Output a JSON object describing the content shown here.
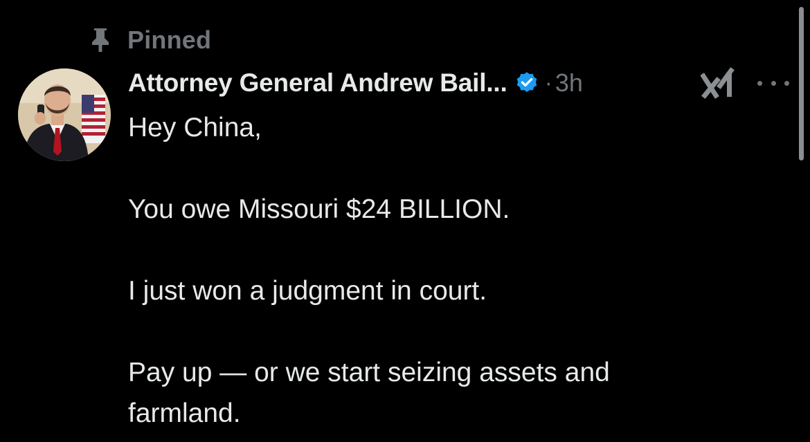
{
  "pinned": {
    "label": "Pinned",
    "icon": "pin-icon"
  },
  "post": {
    "author": {
      "display_name": "Attorney General Andrew Bail...",
      "verified_icon": "verified-badge-icon",
      "avatar_icon": "profile-avatar"
    },
    "separator": "·",
    "timestamp": "3h",
    "grok_icon": "grok-icon",
    "more_icon": "more-options-icon",
    "text": {
      "line1": "Hey China,",
      "line2": "You owe Missouri $24 BILLION.",
      "line3": "I just won a judgment in court.",
      "line4": "Pay up — or we start seizing assets and farmland."
    }
  },
  "colors": {
    "background": "#000000",
    "primary_text": "#e7e9ea",
    "secondary_text": "#71767b",
    "verified_blue": "#1d9bf0"
  }
}
